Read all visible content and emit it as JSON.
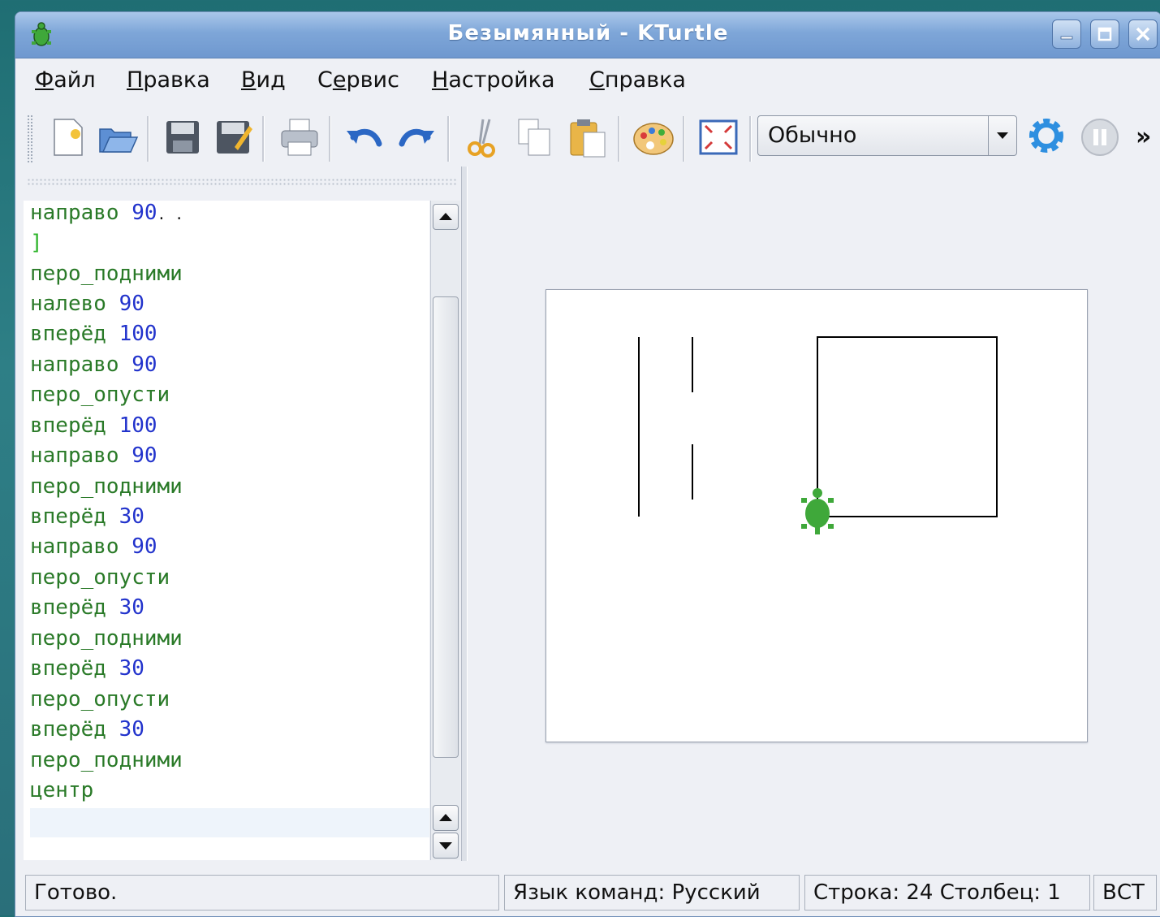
{
  "window": {
    "title": "Безымянный - KTurtle"
  },
  "menu": {
    "items": [
      {
        "accel": "Ф",
        "rest": "айл"
      },
      {
        "accel": "П",
        "rest": "равка"
      },
      {
        "accel": "В",
        "rest": "ид"
      },
      {
        "pre": "С",
        "accel": "е",
        "rest": "рвис"
      },
      {
        "accel": "Н",
        "rest": "астройка"
      },
      {
        "accel": "С",
        "rest": "правка"
      }
    ]
  },
  "toolbar": {
    "speed_selected": "Обычно",
    "overflow": "»",
    "icons": [
      "new-file-icon",
      "open-file-icon",
      "save-icon",
      "save-as-icon",
      "print-icon",
      "undo-icon",
      "redo-icon",
      "cut-icon",
      "copy-icon",
      "paste-icon",
      "color-picker-icon",
      "fullscreen-icon",
      "run-gear-icon",
      "pause-icon"
    ]
  },
  "editor": {
    "lines": [
      {
        "cmd": "направо",
        "arg": "90",
        "suffix": ". ."
      },
      {
        "cmd": "]",
        "arg": "",
        "bracket": true
      },
      {
        "cmd": "перо_подними",
        "arg": ""
      },
      {
        "cmd": "налево",
        "arg": "90"
      },
      {
        "cmd": "вперёд",
        "arg": "100"
      },
      {
        "cmd": "направо",
        "arg": "90"
      },
      {
        "cmd": "перо_опусти",
        "arg": ""
      },
      {
        "cmd": "вперёд",
        "arg": "100"
      },
      {
        "cmd": "направо",
        "arg": "90"
      },
      {
        "cmd": "перо_подними",
        "arg": ""
      },
      {
        "cmd": "вперёд",
        "arg": "30"
      },
      {
        "cmd": "направо",
        "arg": "90"
      },
      {
        "cmd": "перо_опусти",
        "arg": ""
      },
      {
        "cmd": "вперёд",
        "arg": "30"
      },
      {
        "cmd": "перо_подними",
        "arg": ""
      },
      {
        "cmd": "вперёд",
        "arg": "30"
      },
      {
        "cmd": "перо_опусти",
        "arg": ""
      },
      {
        "cmd": "вперёд",
        "arg": "30"
      },
      {
        "cmd": "перо_подними",
        "arg": ""
      },
      {
        "cmd": "центр",
        "arg": ""
      }
    ]
  },
  "status": {
    "message": "Готово.",
    "language": "Язык команд: Русский",
    "position": "Строка: 24 Столбец: 1",
    "mode": "ВСТ"
  },
  "colors": {
    "keyword": "#2a7a28",
    "number": "#2233cc",
    "turtle": "#3fa83a",
    "title_bar": "#7ea6d8"
  }
}
